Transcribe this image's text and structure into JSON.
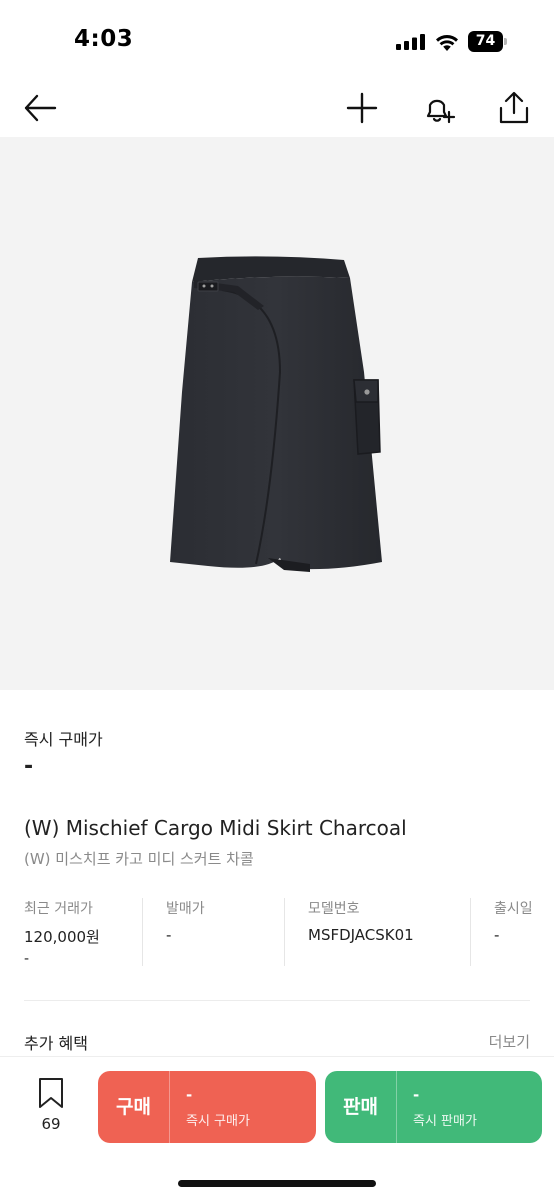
{
  "status_bar": {
    "time": "4:03",
    "battery": "74"
  },
  "nav": {
    "back_icon": "arrow-left-icon",
    "add_icon": "plus-icon",
    "alarm_icon": "bell-plus-icon",
    "share_icon": "share-icon"
  },
  "price": {
    "label": "즉시 구매가",
    "value": "-"
  },
  "product": {
    "title_en": "(W) Mischief Cargo Midi Skirt Charcoal",
    "title_kr": "(W) 미스치프 카고 미디 스커트 차콜"
  },
  "info": [
    {
      "label": "최근 거래가",
      "value": "120,000원",
      "sub": "-"
    },
    {
      "label": "발매가",
      "value": "-"
    },
    {
      "label": "모델번호",
      "value": "MSFDJACSK01"
    },
    {
      "label": "출시일",
      "value": "-"
    }
  ],
  "benefits": {
    "title": "추가 혜택",
    "more": "더보기"
  },
  "bottom": {
    "wish_count": "69",
    "buy": {
      "label": "구매",
      "price": "-",
      "sub": "즉시 구매가"
    },
    "sell": {
      "label": "판매",
      "price": "-",
      "sub": "즉시 판매가"
    }
  },
  "colors": {
    "buy": "#ef6253",
    "sell": "#41b979",
    "image_bg": "#f3f3f3",
    "skirt": "#2a2c31"
  }
}
